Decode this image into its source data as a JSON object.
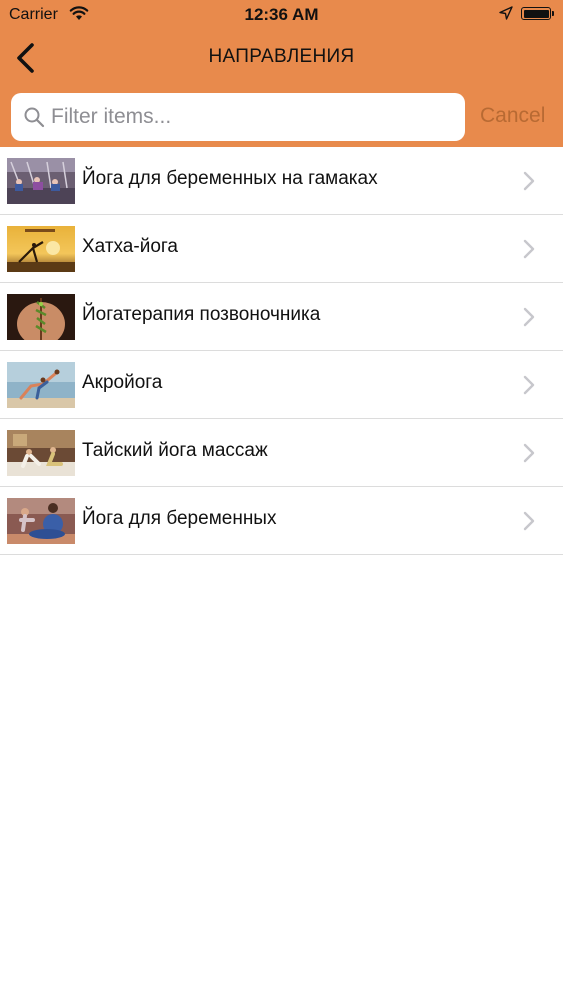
{
  "status_bar": {
    "carrier": "Carrier",
    "time": "12:36 AM",
    "icons": [
      "wifi-icon",
      "location-arrow-icon",
      "battery-icon"
    ]
  },
  "nav": {
    "title": "НАПРАВЛЕНИЯ",
    "back_icon": "chevron-left-icon"
  },
  "search": {
    "placeholder": "Filter items...",
    "value": "",
    "cancel_label": "Cancel",
    "icon": "magnifier-icon"
  },
  "items": [
    {
      "label": "Йога для беременных на гамаках",
      "thumb": "hammock-yoga"
    },
    {
      "label": "Хатха-йога",
      "thumb": "sunset-pose"
    },
    {
      "label": "Йогатерапия позвоночника",
      "thumb": "spine-back"
    },
    {
      "label": "Акройога",
      "thumb": "acro-pair"
    },
    {
      "label": "Тайский йога массаж",
      "thumb": "thai-massage"
    },
    {
      "label": "Йога для беременных",
      "thumb": "pregnant-meditation"
    }
  ],
  "colors": {
    "accent": "#e88a4c",
    "cancel_text": "#b86a33",
    "separator": "#dcdcdc",
    "chevron": "#c7c7cc"
  }
}
